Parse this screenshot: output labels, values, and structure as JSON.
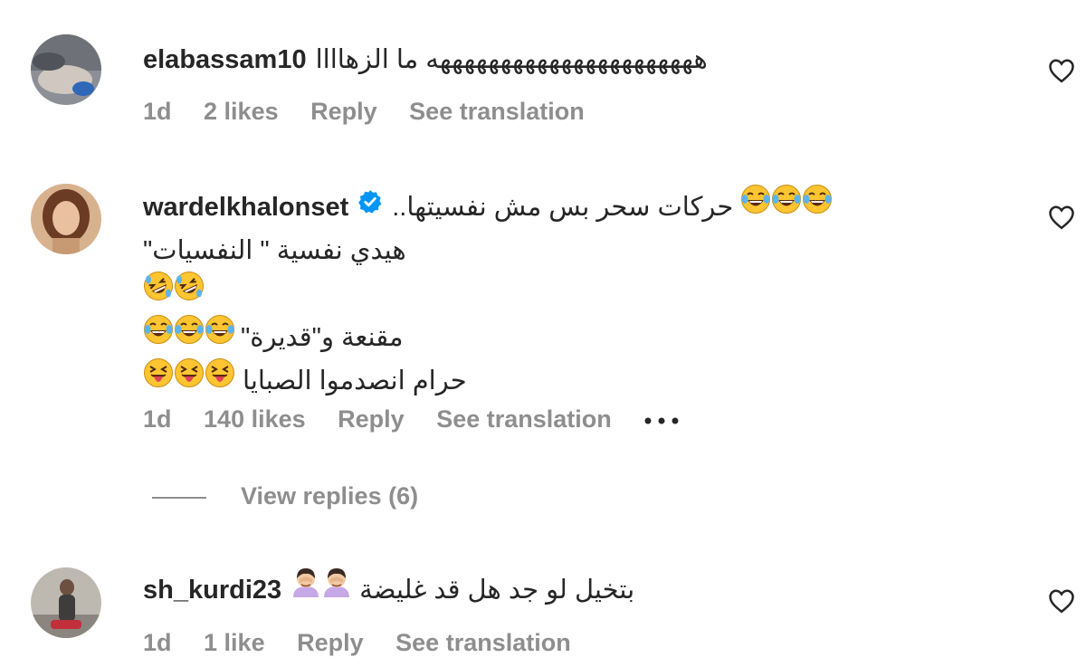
{
  "comments": [
    {
      "username": "elabassam10",
      "verified": false,
      "lines": [
        {
          "text": "ههههههههههههههههههههههه ما الزهاااا",
          "emoji": []
        }
      ],
      "time": "1d",
      "likes": "2 likes",
      "reply": "Reply",
      "translate": "See translation",
      "avatar_icon": "avatar-photo-hand-icon"
    },
    {
      "username": "wardelkhalonset",
      "verified": true,
      "lines": [
        {
          "text": "حركات سحر بس مش نفسيتها..",
          "emoji": [
            "tears-of-joy",
            "tears-of-joy",
            "tears-of-joy"
          ]
        },
        {
          "text": "هيدي نفسية \" النفسيات\"",
          "emoji": []
        },
        {
          "text": "",
          "emoji": [
            "rofl",
            "rofl"
          ]
        },
        {
          "text": "مقنعة و\"قديرة\"",
          "emoji": [
            "tears-of-joy",
            "tears-of-joy",
            "tears-of-joy"
          ]
        },
        {
          "text": "حرام انصدموا الصبايا",
          "emoji": [
            "squinting-tongue",
            "squinting-tongue",
            "squinting-tongue"
          ]
        }
      ],
      "time": "1d",
      "likes": "140 likes",
      "reply": "Reply",
      "translate": "See translation",
      "more_icon": "more-dots-icon",
      "view_replies": "View replies (6)",
      "avatar_icon": "avatar-photo-woman-icon"
    },
    {
      "username": "sh_kurdi23",
      "verified": false,
      "lines": [
        {
          "text": "بتخيل لو جد هل قد غليضة",
          "emoji": [
            "person-facepalming",
            "person-facepalming"
          ]
        }
      ],
      "time": "1d",
      "likes": "1 like",
      "reply": "Reply",
      "translate": "See translation",
      "avatar_icon": "avatar-photo-person-icon"
    }
  ],
  "colors": {
    "text": "#262626",
    "secondary": "#8e8e8e",
    "verified": "#0095f6",
    "emoji_yellow": "#fdc531"
  },
  "icons": {
    "like": "heart-outline-icon",
    "verified": "verified-badge-icon"
  }
}
